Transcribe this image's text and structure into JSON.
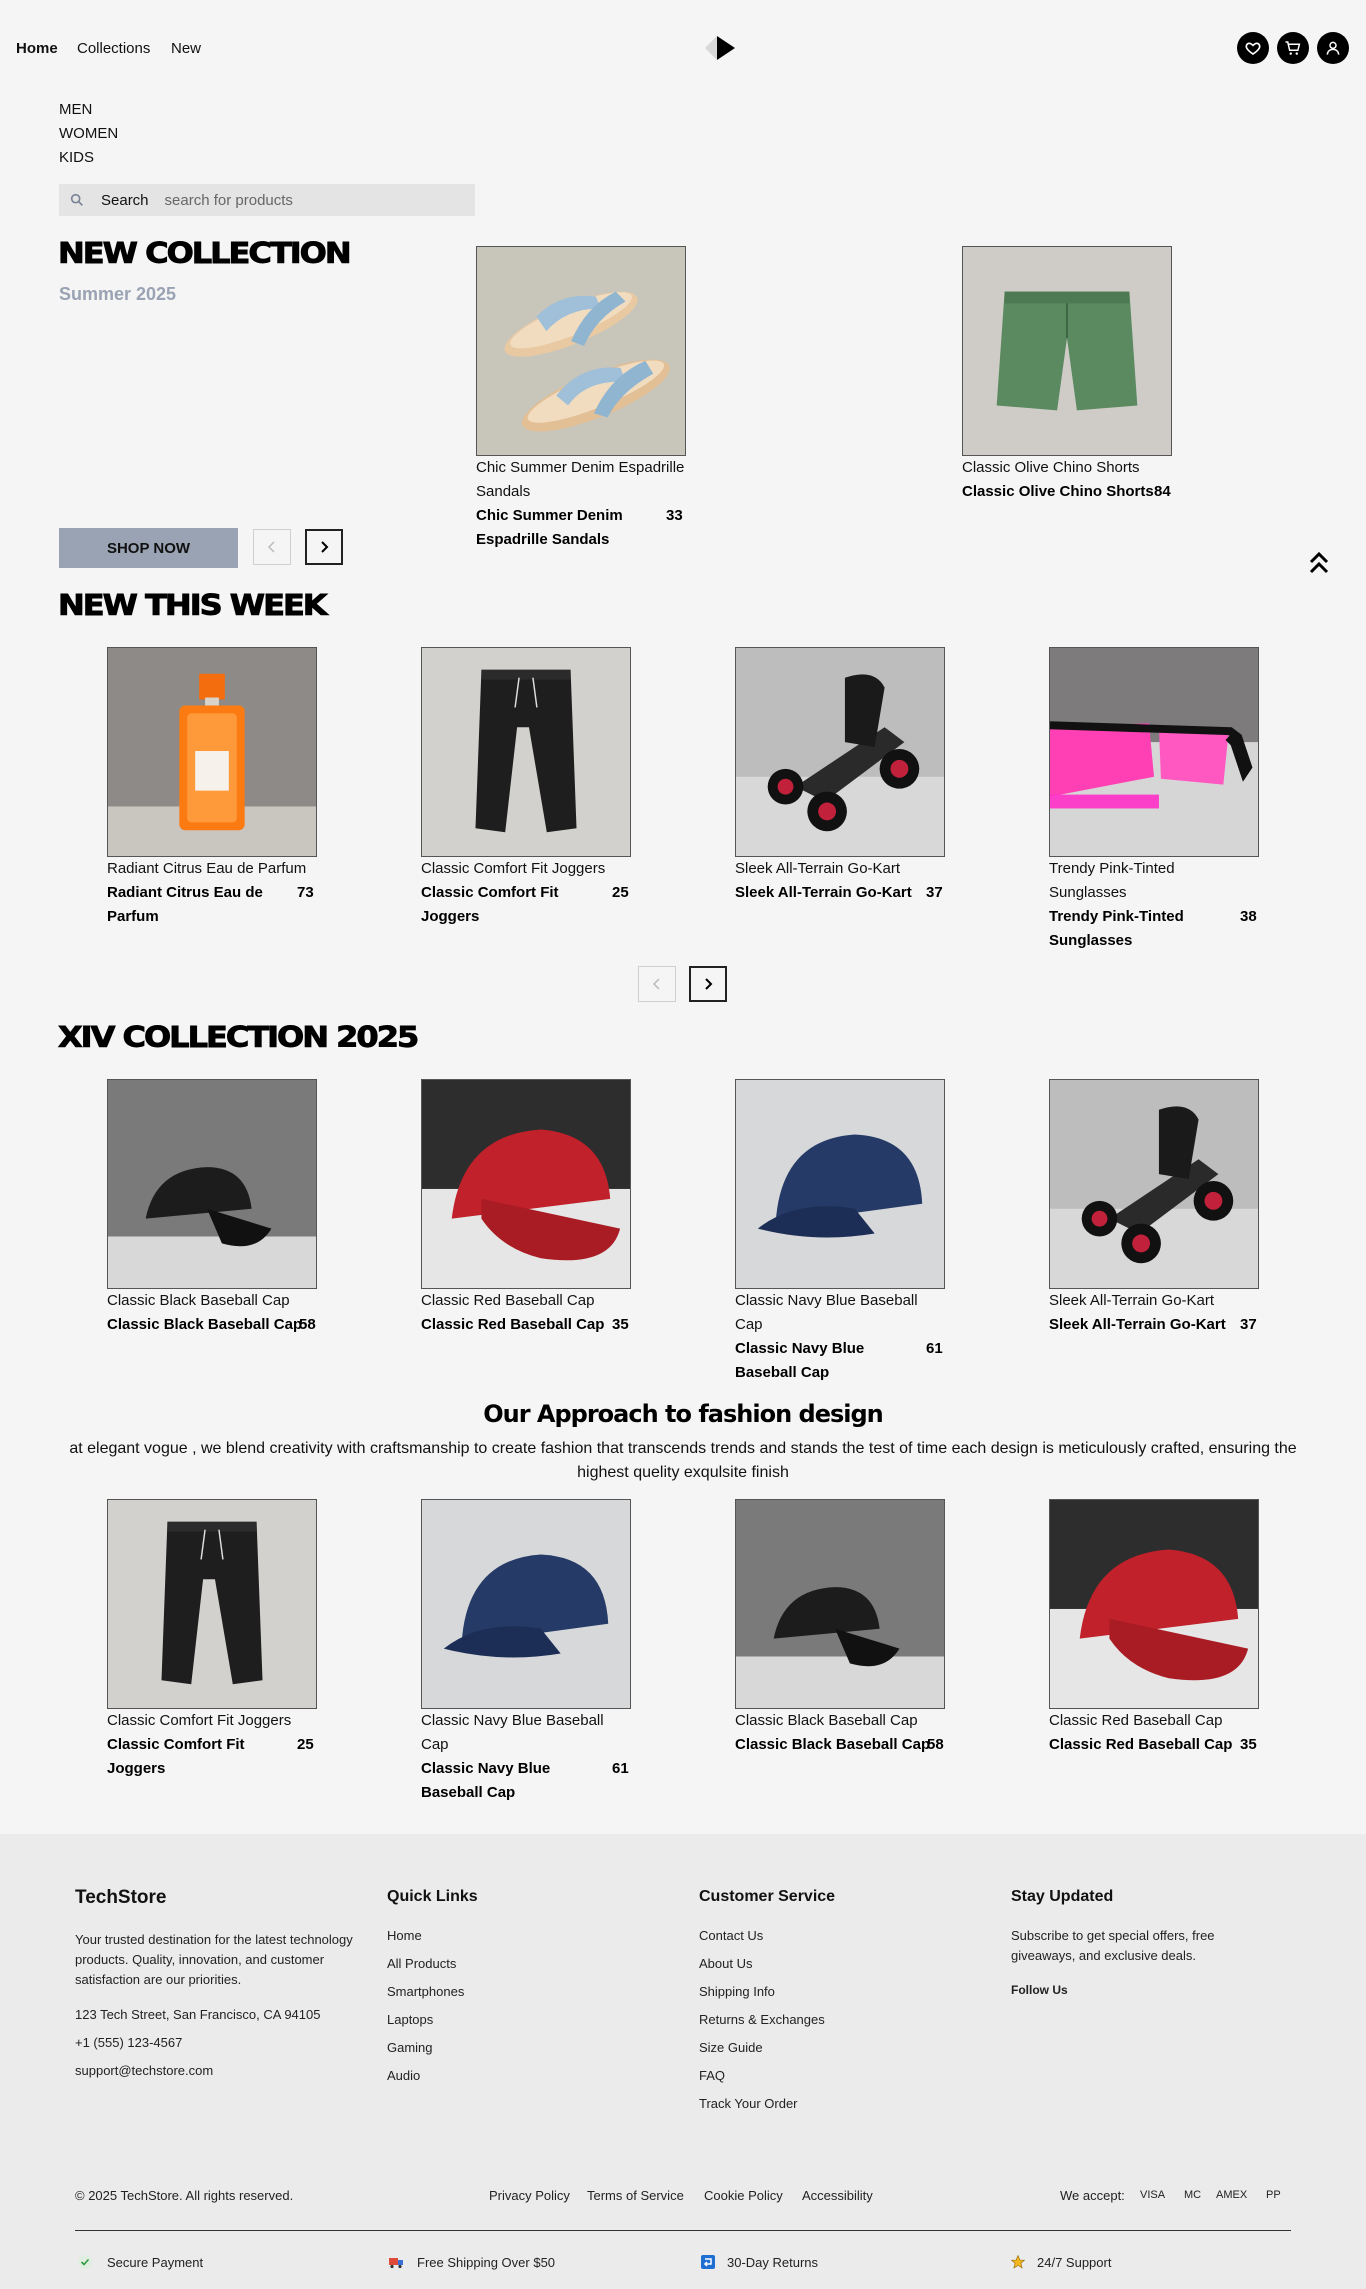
{
  "nav": {
    "links": [
      "Home",
      "Collections",
      "New"
    ],
    "icons": [
      "heart-icon",
      "cart-icon",
      "user-icon"
    ]
  },
  "categories": [
    "MEN",
    "WOMEN",
    "KIDS"
  ],
  "search": {
    "label": "Search",
    "placeholder": "search for products"
  },
  "hero": {
    "title": "NEW COLLECTION",
    "subtitle": "Summer 2025",
    "shop_button": "SHOP NOW",
    "products": [
      {
        "name": "Chic Summer Denim Espadrille Sandals",
        "price": "33"
      },
      {
        "name": "Classic Olive Chino Shorts",
        "price": "84"
      }
    ]
  },
  "new_this_week": {
    "title": "NEW THIS WEEK",
    "products": [
      {
        "name": "Radiant Citrus Eau de Parfum",
        "price": "73"
      },
      {
        "name": "Classic Comfort Fit Joggers",
        "price": "25"
      },
      {
        "name": "Sleek All-Terrain Go-Kart",
        "price": "37"
      },
      {
        "name": "Trendy Pink-Tinted Sunglasses",
        "price": "38"
      }
    ]
  },
  "xiv_collection": {
    "title": "XIV COLLECTION 2025",
    "products": [
      {
        "name": "Classic Black Baseball Cap",
        "price": "58"
      },
      {
        "name": "Classic Red Baseball Cap",
        "price": "35"
      },
      {
        "name": "Classic Navy Blue Baseball Cap",
        "price": "61"
      },
      {
        "name": "Sleek All-Terrain Go-Kart",
        "price": "37"
      }
    ]
  },
  "approach": {
    "title": "Our Approach to fashion design",
    "text": "at elegant vogue , we blend creativity with craftsmanship to create fashion that transcends trends and stands the test of time each design is meticulously crafted, ensuring the highest quelity exqulsite finish",
    "products": [
      {
        "name": "Classic Comfort Fit Joggers",
        "price": "25"
      },
      {
        "name": "Classic Navy Blue Baseball Cap",
        "price": "61"
      },
      {
        "name": "Classic Black Baseball Cap",
        "price": "58"
      },
      {
        "name": "Classic Red Baseball Cap",
        "price": "35"
      }
    ]
  },
  "footer": {
    "brand": "TechStore",
    "description": "Your trusted destination for the latest technology products. Quality, innovation, and customer satisfaction are our priorities.",
    "address": "123 Tech Street, San Francisco, CA 94105",
    "phone": "+1 (555) 123-4567",
    "email": "support@techstore.com",
    "quick_links_title": "Quick Links",
    "quick_links": [
      "Home",
      "All Products",
      "Smartphones",
      "Laptops",
      "Gaming",
      "Audio"
    ],
    "customer_service_title": "Customer Service",
    "customer_service": [
      "Contact Us",
      "About Us",
      "Shipping Info",
      "Returns & Exchanges",
      "Size Guide",
      "FAQ",
      "Track Your Order"
    ],
    "stay_updated_title": "Stay Updated",
    "stay_updated_text": "Subscribe to get special offers, free giveaways, and exclusive deals.",
    "follow_us": "Follow Us",
    "copyright": "© 2025 TechStore. All rights reserved.",
    "legal_links": [
      "Privacy Policy",
      "Terms of Service",
      "Cookie Policy",
      "Accessibility"
    ],
    "we_accept": "We accept:",
    "payment_methods": [
      "VISA",
      "MC",
      "AMEX",
      "PP"
    ],
    "badges": [
      "Secure Payment",
      "Free Shipping Over $50",
      "30-Day Returns",
      "24/7 Support"
    ]
  }
}
